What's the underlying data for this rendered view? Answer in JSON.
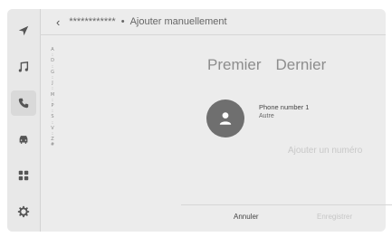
{
  "header": {
    "back_icon": "chevron-left-icon",
    "contact_name": "************",
    "separator": "•",
    "title": "Ajouter manuellement"
  },
  "sidebar": {
    "items": [
      {
        "icon": "navigation-arrow-icon",
        "active": false
      },
      {
        "icon": "music-note-icon",
        "active": false
      },
      {
        "icon": "phone-icon",
        "active": true
      },
      {
        "icon": "car-icon",
        "active": false
      },
      {
        "icon": "apps-grid-icon",
        "active": false
      },
      {
        "icon": "gear-icon",
        "active": false
      }
    ]
  },
  "index_bar": [
    "A",
    ":",
    "D",
    ":",
    "G",
    ":",
    "J",
    ":",
    "M",
    ":",
    "P",
    ":",
    "S",
    ":",
    "V",
    ":",
    "Z",
    "#"
  ],
  "form": {
    "first_name": "Premier",
    "last_name": "Dernier",
    "avatar_icon": "person-icon",
    "phone_label": "Phone number 1",
    "phone_type": "Autre",
    "add_number": "Ajouter un numéro"
  },
  "footer": {
    "cancel": "Annuler",
    "save": "Enregistrer"
  }
}
